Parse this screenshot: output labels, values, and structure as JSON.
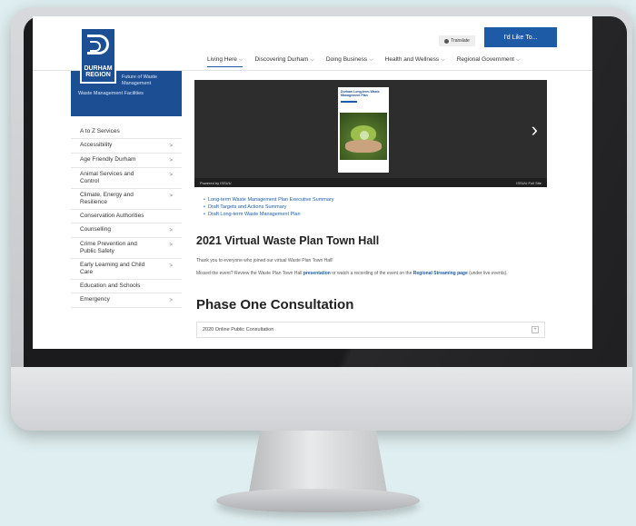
{
  "header": {
    "logo_text": "DURHAM REGION",
    "translate_label": "Translate",
    "cta_label": "I'd Like To...",
    "nav": [
      {
        "label": "Living Here",
        "active": true
      },
      {
        "label": "Discovering Durham",
        "active": false
      },
      {
        "label": "Doing Business",
        "active": false
      },
      {
        "label": "Health and Wellness",
        "active": false
      },
      {
        "label": "Regional Government",
        "active": false
      }
    ]
  },
  "sidebar": {
    "sub_items": [
      "Future of Waste Management",
      "Waste Management Facilities"
    ],
    "items": [
      {
        "label": "A to Z Services",
        "has_children": false
      },
      {
        "label": "Accessibility",
        "has_children": true
      },
      {
        "label": "Age Friendly Durham",
        "has_children": true
      },
      {
        "label": "Animal Services and Control",
        "has_children": true
      },
      {
        "label": "Climate, Energy and Resilience",
        "has_children": true
      },
      {
        "label": "Conservation Authorities",
        "has_children": false
      },
      {
        "label": "Counselling",
        "has_children": true
      },
      {
        "label": "Crime Prevention and Public Safety",
        "has_children": true
      },
      {
        "label": "Early Learning and Child Care",
        "has_children": true
      },
      {
        "label": "Education and Schools",
        "has_children": false
      },
      {
        "label": "Emergency",
        "has_children": true
      }
    ]
  },
  "main": {
    "video": {
      "poster_title": "Durham Long-term Waste Management Plan",
      "powered_by": "Powered by ISSUU",
      "footer_right": "ISSUU Full Site"
    },
    "links": [
      "Long-term Waste Management Plan Executive Summary",
      "Draft Targets and Actions Summary",
      "Draft Long-term Waste Management Plan"
    ],
    "town_hall_heading": "2021 Virtual Waste Plan Town Hall",
    "town_hall_p1": "Thank you to everyone who joined our virtual Waste Plan Town Hall!",
    "town_hall_p2_a": "Missed the event? Review the Waste Plan Town Hall ",
    "town_hall_p2_link1": "presentation",
    "town_hall_p2_b": " or watch a recording of the event on the ",
    "town_hall_p2_link2": "Regional Streaming page",
    "town_hall_p2_c": " (under live events).",
    "phase_heading": "Phase One Consultation",
    "accordion_label": "2020 Online Public Consultation",
    "accordion_icon": "plus-icon"
  }
}
